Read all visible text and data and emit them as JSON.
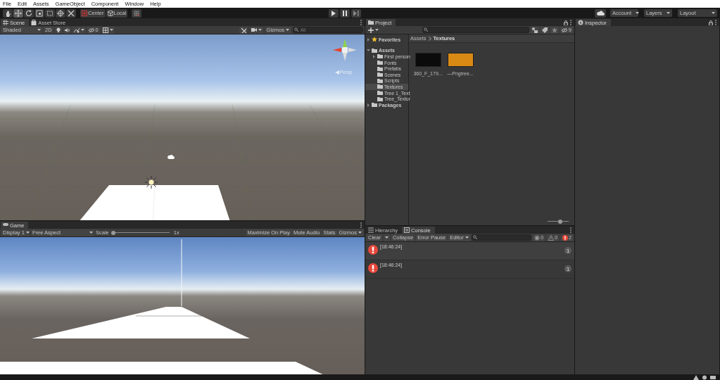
{
  "menu_bar": [
    {
      "label": "File"
    },
    {
      "label": "Edit"
    },
    {
      "label": "Assets"
    },
    {
      "label": "GameObject"
    },
    {
      "label": "Component"
    },
    {
      "label": "Window"
    },
    {
      "label": "Help"
    }
  ],
  "toolbar": {
    "tools": [
      {
        "selected": false
      },
      {
        "selected": true
      },
      {
        "selected": false
      },
      {
        "selected": false
      },
      {
        "selected": false
      },
      {
        "selected": false
      },
      {
        "selected": false
      }
    ],
    "pivot": "Center",
    "space": "Local",
    "account": "Account",
    "layers": "Layers",
    "layout": "Layout"
  },
  "scene_panel": {
    "tabs": [
      {
        "label": "Scene",
        "selected": true
      },
      {
        "label": "Asset Store",
        "selected": false
      }
    ],
    "shading": "Shaded",
    "mode_2d": "2D",
    "hidden_count": "0",
    "gizmos": "Gizmos",
    "search": {
      "placeholder": "All"
    },
    "projection": "Persp"
  },
  "game_panel": {
    "tabs": [
      {
        "label": "Game",
        "selected": true
      }
    ],
    "display": "Display 1",
    "aspect": "Free Aspect",
    "scale_label": "Scale",
    "scale": {
      "level": 0
    },
    "scale_value": "1x",
    "buttons": [
      {
        "label": "Maximize On Play"
      },
      {
        "label": "Mute Audio"
      },
      {
        "label": "Stats"
      }
    ],
    "gizmos": "Gizmos"
  },
  "project_panel": {
    "tabs": [
      {
        "label": "Project",
        "selected": true
      }
    ],
    "hidden_count": "9",
    "tree": [
      {
        "label": "Favorites",
        "kind": "favorites",
        "expandable": true,
        "expanded": false,
        "selected": false
      },
      {
        "label": "Assets",
        "kind": "folder",
        "expandable": true,
        "expanded": true,
        "selected": false,
        "children": [
          {
            "label": "First person",
            "kind": "folder",
            "expandable": true,
            "expanded": false,
            "selected": false
          },
          {
            "label": "Fonts",
            "kind": "folder",
            "expandable": false,
            "selected": false
          },
          {
            "label": "Prefabs",
            "kind": "folder",
            "expandable": false,
            "selected": false
          },
          {
            "label": "Scenes",
            "kind": "folder",
            "expandable": false,
            "selected": false
          },
          {
            "label": "Scripts",
            "kind": "folder",
            "expandable": false,
            "selected": false
          },
          {
            "label": "Textures",
            "kind": "folder",
            "expandable": false,
            "selected": true
          },
          {
            "label": "Tree 1_Text",
            "kind": "folder",
            "expandable": false,
            "selected": false
          },
          {
            "label": "Tree_Textur",
            "kind": "folder",
            "expandable": false,
            "selected": false
          }
        ]
      },
      {
        "label": "Packages",
        "kind": "folder",
        "expandable": true,
        "expanded": false,
        "selected": false
      }
    ],
    "breadcrumb": [
      "Assets",
      "Textures"
    ],
    "assets": [
      {
        "name": "360_F_179...",
        "color": "#0b0b0b"
      },
      {
        "name": "—Pngtree...",
        "color": "#d98a14"
      }
    ],
    "icon_size": {
      "level": 0.6
    }
  },
  "console_panel": {
    "tabs": [
      {
        "label": "Hierarchy",
        "selected": false
      },
      {
        "label": "Console",
        "selected": true
      }
    ],
    "clear": "Clear",
    "collapse": "Collapse",
    "error_pause": "Error Pause",
    "editor": "Editor",
    "counts": [
      {
        "kind": "info",
        "count": "0"
      },
      {
        "kind": "warning",
        "count": "0"
      },
      {
        "kind": "error",
        "count": "2"
      }
    ],
    "entries": [
      {
        "kind": "error",
        "time": "[18:46:24]",
        "count": "1"
      },
      {
        "kind": "error",
        "time": "[18:46:24]",
        "count": "1"
      }
    ]
  },
  "inspector_panel": {
    "tabs": [
      {
        "label": "Inspector",
        "selected": true
      }
    ]
  }
}
